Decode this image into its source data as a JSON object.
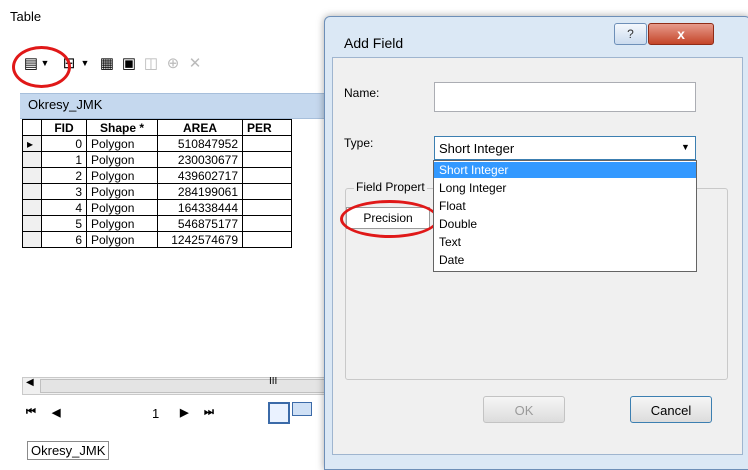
{
  "table_window": {
    "title": "Table",
    "layer_tab": "Okresy_JMK",
    "bottom_tab": "Okresy_JMK",
    "columns": [
      "FID",
      "Shape *",
      "AREA",
      "PER"
    ],
    "rows": [
      {
        "fid": "0",
        "shape": "Polygon",
        "area": "510847952",
        "marker": "▸"
      },
      {
        "fid": "1",
        "shape": "Polygon",
        "area": "230030677",
        "marker": ""
      },
      {
        "fid": "2",
        "shape": "Polygon",
        "area": "439602717",
        "marker": ""
      },
      {
        "fid": "3",
        "shape": "Polygon",
        "area": "284199061",
        "marker": ""
      },
      {
        "fid": "4",
        "shape": "Polygon",
        "area": "164338444",
        "marker": ""
      },
      {
        "fid": "5",
        "shape": "Polygon",
        "area": "546875177",
        "marker": ""
      },
      {
        "fid": "6",
        "shape": "Polygon",
        "area": "1242574679",
        "marker": ""
      }
    ],
    "nav": {
      "first": "⏮",
      "prev": "◀",
      "page": "1",
      "next": "▶",
      "last": "⏭"
    },
    "scroll_grip": "III"
  },
  "dialog": {
    "title": "Add Field",
    "help_label": "?",
    "close_label": "x",
    "name_label": "Name:",
    "name_value": "",
    "type_label": "Type:",
    "type_value": "Short Integer",
    "type_options": [
      "Short Integer",
      "Long Integer",
      "Float",
      "Double",
      "Text",
      "Date"
    ],
    "field_properties_label": "Field Propert",
    "precision_label": "Precision",
    "ok_label": "OK",
    "cancel_label": "Cancel"
  },
  "colors": {
    "highlight": "#e01818",
    "selection": "#3399ff",
    "close_button": "#c44529"
  }
}
